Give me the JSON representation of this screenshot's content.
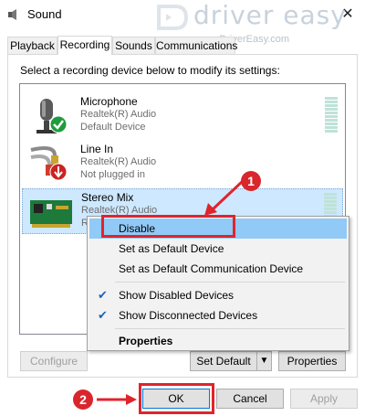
{
  "window": {
    "title": "Sound",
    "close_glyph": "✕"
  },
  "watermark": {
    "brand": "driver easy",
    "url": "www.DriverEasy.com"
  },
  "tabs": [
    {
      "label": "Playback"
    },
    {
      "label": "Recording",
      "active": true
    },
    {
      "label": "Sounds"
    },
    {
      "label": "Communications"
    }
  ],
  "instruction": "Select a recording device below to modify its settings:",
  "devices": [
    {
      "name": "Microphone",
      "driver": "Realtek(R) Audio",
      "status": "Default Device",
      "icon": "microphone-icon",
      "badge": "green-check-icon"
    },
    {
      "name": "Line In",
      "driver": "Realtek(R) Audio",
      "status": "Not plugged in",
      "icon": "line-in-cable-icon",
      "badge": "red-down-arrow-icon"
    },
    {
      "name": "Stereo Mix",
      "driver": "Realtek(R) Audio",
      "status": "R",
      "icon": "sound-card-icon",
      "selected": true
    }
  ],
  "context_menu": {
    "items": [
      {
        "label": "Disable",
        "highlighted": true
      },
      {
        "label": "Set as Default Device"
      },
      {
        "label": "Set as Default Communication Device"
      },
      {
        "label": "Show Disabled Devices",
        "checked": true
      },
      {
        "label": "Show Disconnected Devices",
        "checked": true
      },
      {
        "label": "Properties",
        "bold": true
      }
    ],
    "check_glyph": "✔"
  },
  "buttons": {
    "configure": "Configure",
    "set_default": "Set Default",
    "set_default_arrow": "▼",
    "properties": "Properties",
    "ok": "OK",
    "cancel": "Cancel",
    "apply": "Apply"
  },
  "annotations": {
    "step1": "1",
    "step2": "2",
    "color": "#e0242c"
  }
}
